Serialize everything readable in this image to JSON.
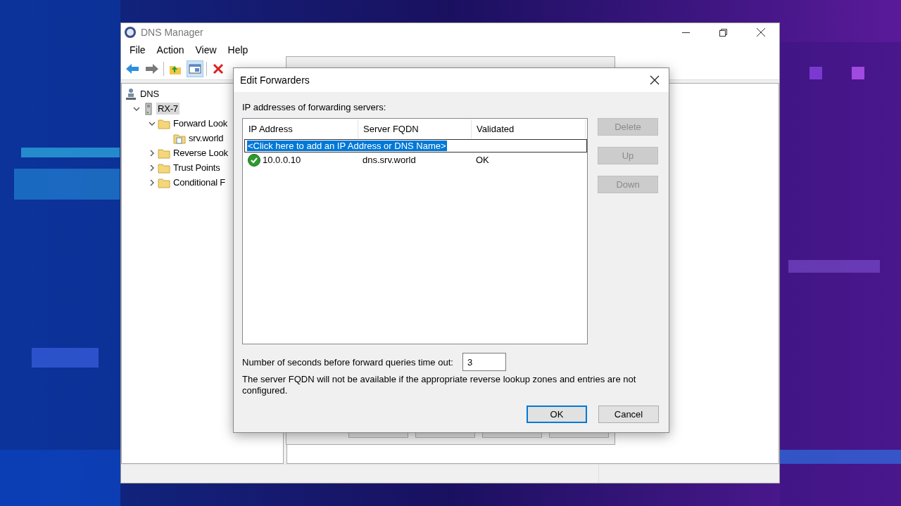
{
  "window": {
    "title": "DNS Manager",
    "menu": [
      "File",
      "Action",
      "View",
      "Help"
    ]
  },
  "tree": [
    {
      "label": "DNS",
      "kind": "dns",
      "selected": false,
      "children": [
        {
          "label": "RX-7",
          "kind": "server",
          "expanded": true,
          "selected": true,
          "children": [
            {
              "label": "Forward Look",
              "kind": "folder",
              "expanded": true,
              "selected": false,
              "children": [
                {
                  "label": "srv.world",
                  "kind": "zone",
                  "selected": false
                }
              ]
            },
            {
              "label": "Reverse Look",
              "kind": "folder",
              "expanded": false,
              "selected": false
            },
            {
              "label": "Trust Points",
              "kind": "folder",
              "expanded": false,
              "selected": false
            },
            {
              "label": "Conditional F",
              "kind": "folder",
              "expanded": false,
              "selected": false
            }
          ]
        }
      ]
    }
  ],
  "dialog": {
    "title": "Edit Forwarders",
    "list_label": "IP addresses of forwarding servers:",
    "columns": [
      "IP Address",
      "Server FQDN",
      "Validated"
    ],
    "add_row": {
      "text": "<Click here to add an IP Address or DNS Name>",
      "selected": true
    },
    "rows": [
      {
        "ip": "10.0.0.10",
        "fqdn": "dns.srv.world",
        "validated": "OK",
        "valid": true
      }
    ],
    "side_buttons": [
      {
        "label": "Delete",
        "disabled": true
      },
      {
        "label": "Up",
        "disabled": true
      },
      {
        "label": "Down",
        "disabled": true
      }
    ],
    "timeout_label": "Number of seconds before forward queries time out:",
    "timeout_value": "3",
    "note": "The server FQDN will not be available if the appropriate reverse lookup zones and entries are not configured.",
    "buttons": [
      {
        "label": "OK",
        "default": true
      },
      {
        "label": "Cancel",
        "default": false
      }
    ]
  }
}
